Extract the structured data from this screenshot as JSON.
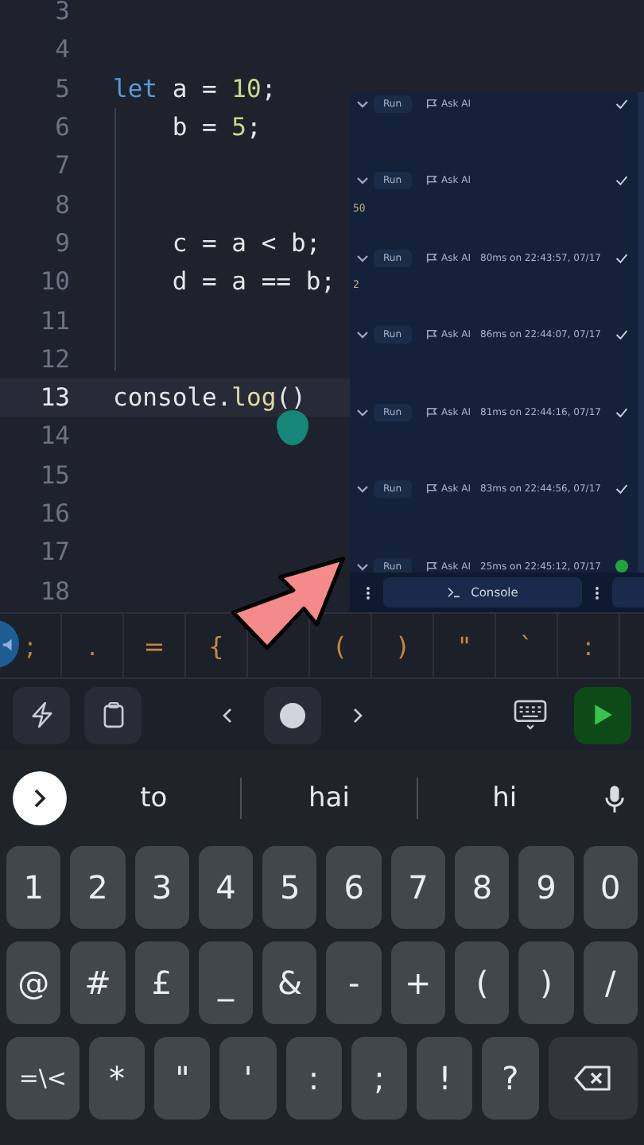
{
  "editor": {
    "lines": [
      {
        "number": "3",
        "current": false
      },
      {
        "number": "4",
        "current": false
      },
      {
        "number": "5",
        "code": [
          {
            "t": "let",
            "kind": "keyword"
          },
          {
            "t": " a = ",
            "kind": "plain"
          },
          {
            "t": "10",
            "kind": "number"
          },
          {
            "t": ";",
            "kind": "plain"
          }
        ],
        "current": false
      },
      {
        "number": "6",
        "code": [
          {
            "t": "    b = ",
            "kind": "plain"
          },
          {
            "t": "5",
            "kind": "number"
          },
          {
            "t": ";",
            "kind": "plain"
          }
        ],
        "current": false
      },
      {
        "number": "7",
        "current": false
      },
      {
        "number": "8",
        "current": false
      },
      {
        "number": "9",
        "code": [
          {
            "t": "    c = a < b;",
            "kind": "plain"
          }
        ],
        "current": false
      },
      {
        "number": "10",
        "code": [
          {
            "t": "    d = a == b;",
            "kind": "plain"
          }
        ],
        "current": false
      },
      {
        "number": "11",
        "current": false
      },
      {
        "number": "12",
        "current": false
      },
      {
        "number": "13",
        "code": [
          {
            "t": "console.",
            "kind": "plain"
          },
          {
            "t": "log",
            "kind": "function"
          },
          {
            "t": "()",
            "kind": "plain"
          }
        ],
        "current": true
      },
      {
        "number": "14",
        "current": false
      },
      {
        "number": "15",
        "current": false
      },
      {
        "number": "16",
        "current": false
      },
      {
        "number": "17",
        "current": false
      },
      {
        "number": "18",
        "current": false
      }
    ]
  },
  "console": {
    "entries": [
      {
        "run": "Run",
        "ask": "Ask AI",
        "kind": "done"
      },
      {
        "run": "Run",
        "ask": "Ask AI",
        "output": "50",
        "kind": "done"
      },
      {
        "run": "Run",
        "ask": "Ask AI",
        "time": "80ms on 22:43:57, 07/17",
        "output": "2",
        "kind": "done"
      },
      {
        "run": "Run",
        "ask": "Ask AI",
        "time": "86ms on 22:44:07, 07/17",
        "kind": "done"
      },
      {
        "run": "Run",
        "ask": "Ask AI",
        "time": "81ms on 22:44:16, 07/17",
        "kind": "done"
      },
      {
        "run": "Run",
        "ask": "Ask AI",
        "time": "83ms on 22:44:56, 07/17",
        "kind": "done"
      },
      {
        "run": "Run",
        "ask": "Ask AI",
        "time": "25ms on 22:45:12, 07/17",
        "kind": "latest"
      }
    ],
    "tab": "Console"
  },
  "symbols": [
    ";",
    ".",
    "=",
    "{",
    "(",
    ")",
    "\"",
    "`",
    ":"
  ],
  "suggestions": [
    "to",
    "hai",
    "hi"
  ],
  "keys": [
    [
      "1",
      "2",
      "3",
      "4",
      "5",
      "6",
      "7",
      "8",
      "9",
      "0"
    ],
    [
      "@",
      "#",
      "£",
      "_",
      "&",
      "-",
      "+",
      "(",
      ")",
      "/"
    ],
    [
      "=\\<",
      "*",
      "\"",
      "'",
      ":",
      ";",
      "!",
      "?"
    ]
  ]
}
